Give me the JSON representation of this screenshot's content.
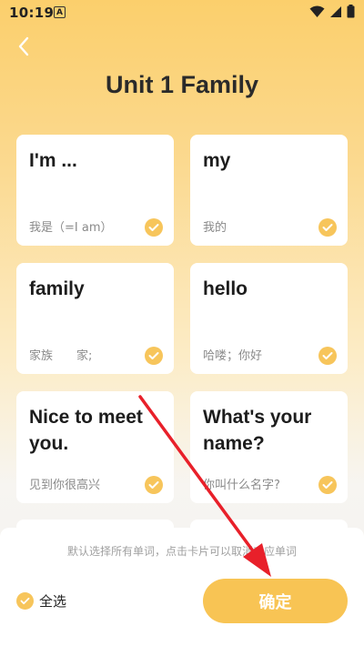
{
  "status": {
    "time": "10:19",
    "indicator": "A"
  },
  "header": {
    "back_icon": "chevron-left-icon",
    "title": "Unit 1 Family"
  },
  "cards": [
    {
      "word": "I'm ...",
      "meaning": "我是（=I am）",
      "selected": true
    },
    {
      "word": "my",
      "meaning": "我的",
      "selected": true
    },
    {
      "word": "family",
      "meaning": "家族　　家;",
      "selected": true
    },
    {
      "word": "hello",
      "meaning": "哈喽；你好",
      "selected": true
    },
    {
      "word": "Nice to meet you.",
      "meaning": "见到你很高兴",
      "selected": true
    },
    {
      "word": "What's your name?",
      "meaning": "你叫什么名字?",
      "selected": true
    }
  ],
  "bottom": {
    "hint": "默认选择所有单词，点击卡片可以取消对应单词",
    "select_all_label": "全选",
    "confirm_label": "确定"
  },
  "colors": {
    "accent": "#f8c454",
    "annotation_arrow": "#e8202a"
  }
}
